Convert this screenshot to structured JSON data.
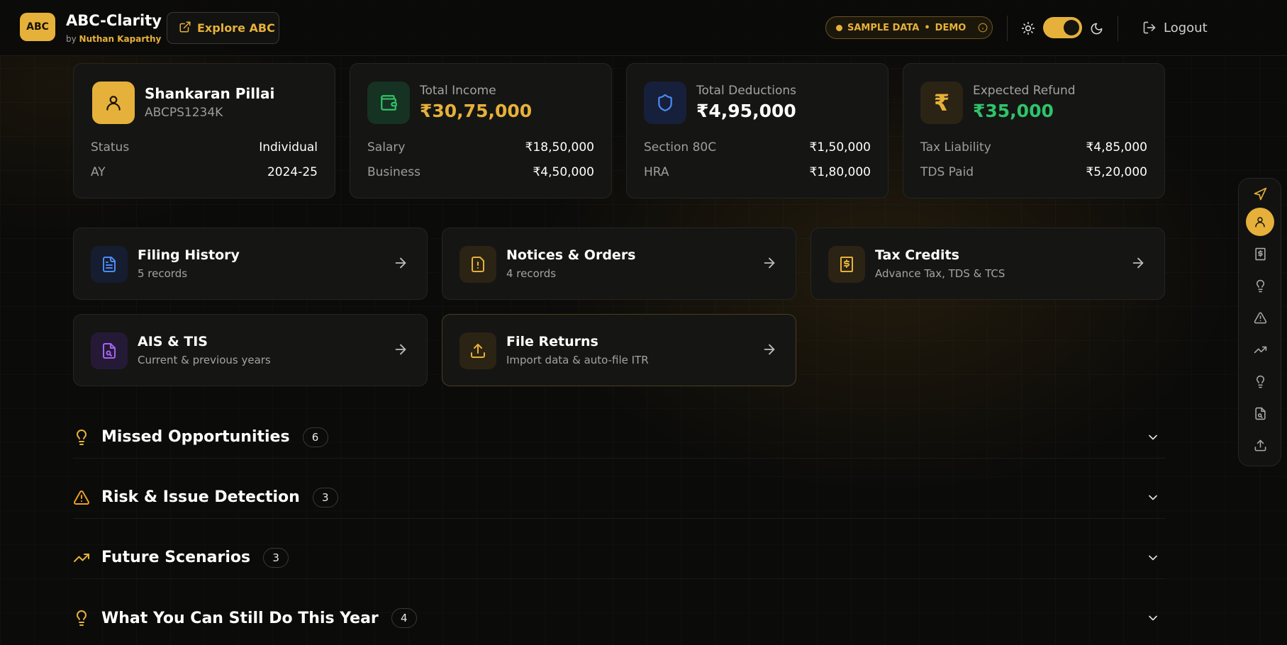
{
  "header": {
    "logo_text": "ABC",
    "app_title": "ABC-Clarity",
    "byline_prefix": "by",
    "author": "Nuthan Kaparthy",
    "explore_label": "Explore ABC",
    "demo_pill": {
      "label_sample": "SAMPLE DATA",
      "separator": "•",
      "label_demo": "DEMO"
    },
    "theme": {
      "mode": "dark"
    },
    "logout_label": "Logout"
  },
  "profile": {
    "name": "Shankaran Pillai",
    "pan": "ABCPS1234K",
    "rows": [
      {
        "key": "Status",
        "value": "Individual"
      },
      {
        "key": "AY",
        "value": "2024-25"
      }
    ]
  },
  "income": {
    "label": "Total Income",
    "value": "₹30,75,000",
    "rows": [
      {
        "key": "Salary",
        "value": "₹18,50,000"
      },
      {
        "key": "Business",
        "value": "₹4,50,000"
      }
    ]
  },
  "deductions": {
    "label": "Total Deductions",
    "value": "₹4,95,000",
    "rows": [
      {
        "key": "Section 80C",
        "value": "₹1,50,000"
      },
      {
        "key": "HRA",
        "value": "₹1,80,000"
      }
    ]
  },
  "refund": {
    "label": "Expected Refund",
    "icon_glyph": "₹",
    "value": "₹35,000",
    "rows": [
      {
        "key": "Tax Liability",
        "value": "₹4,85,000"
      },
      {
        "key": "TDS Paid",
        "value": "₹5,20,000"
      }
    ]
  },
  "nav_cards": [
    {
      "title": "Filing History",
      "subtitle": "5 records"
    },
    {
      "title": "Notices & Orders",
      "subtitle": "4 records"
    },
    {
      "title": "Tax Credits",
      "subtitle": "Advance Tax, TDS & TCS"
    },
    {
      "title": "AIS & TIS",
      "subtitle": "Current & previous years"
    },
    {
      "title": "File Returns",
      "subtitle": "Import data & auto-file ITR"
    }
  ],
  "sections": [
    {
      "title": "Missed Opportunities",
      "count": "6"
    },
    {
      "title": "Risk & Issue Detection",
      "count": "3"
    },
    {
      "title": "Future Scenarios",
      "count": "3"
    },
    {
      "title": "What You Can Still Do This Year",
      "count": "4"
    }
  ],
  "colors": {
    "accent": "#e6b13a",
    "positive": "#2fc36a",
    "background": "#0b0b0a",
    "card": "#151514"
  }
}
